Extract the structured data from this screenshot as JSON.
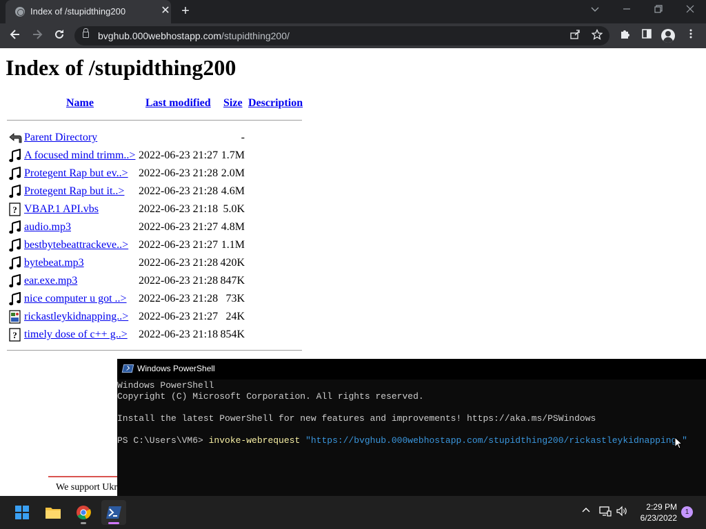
{
  "browser": {
    "tab_title": "Index of /stupidthing200",
    "tab_close": "✕",
    "new_tab": "+",
    "url_host": "bvghub.000webhostapp.com",
    "url_path": "/stupidthing200/",
    "window_controls": [
      "minimize",
      "restore",
      "close"
    ]
  },
  "page": {
    "heading": "Index of /stupidthing200",
    "columns": {
      "name": "Name",
      "last_modified": "Last modified",
      "size": "Size",
      "description": "Description"
    },
    "entries": [
      {
        "icon": "back-arrow",
        "name": "Parent Directory",
        "modified": "",
        "size": "-"
      },
      {
        "icon": "music-note",
        "name": "A focused mind trimm..>",
        "modified": "2022-06-23 21:27",
        "size": "1.7M"
      },
      {
        "icon": "music-note",
        "name": "Protegent Rap but ev..>",
        "modified": "2022-06-23 21:28",
        "size": "2.0M"
      },
      {
        "icon": "music-note",
        "name": "Protegent Rap but it..>",
        "modified": "2022-06-23 21:28",
        "size": "4.6M"
      },
      {
        "icon": "unknown-file",
        "name": "VBAP.1 API.vbs",
        "modified": "2022-06-23 21:18",
        "size": "5.0K"
      },
      {
        "icon": "music-note",
        "name": "audio.mp3",
        "modified": "2022-06-23 21:27",
        "size": "4.8M"
      },
      {
        "icon": "music-note",
        "name": "bestbytebeattrackeve..>",
        "modified": "2022-06-23 21:27",
        "size": "1.1M"
      },
      {
        "icon": "music-note",
        "name": "bytebeat.mp3",
        "modified": "2022-06-23 21:28",
        "size": "420K"
      },
      {
        "icon": "music-note",
        "name": "ear.exe.mp3",
        "modified": "2022-06-23 21:28",
        "size": "847K"
      },
      {
        "icon": "music-note",
        "name": "nice computer u got ..>",
        "modified": "2022-06-23 21:28",
        "size": "73K"
      },
      {
        "icon": "image-file",
        "name": "rickastleykidnapping..>",
        "modified": "2022-06-23 21:27",
        "size": "24K"
      },
      {
        "icon": "unknown-file",
        "name": "timely dose of c++ g..>",
        "modified": "2022-06-23 21:18",
        "size": "854K"
      }
    ],
    "banner_text": "We support Ukr"
  },
  "powershell": {
    "title": "Windows PowerShell",
    "lines": [
      "Windows PowerShell",
      "Copyright (C) Microsoft Corporation. All rights reserved.",
      "",
      "Install the latest PowerShell for new features and improvements! https://aka.ms/PSWindows",
      ""
    ],
    "prompt": "PS C:\\Users\\VM6> ",
    "command": "invoke-webrequest",
    "argument": "\"https://bvghub.000webhostapp.com/stupidthing200/rickastleykidnapping.\""
  },
  "taskbar": {
    "apps": [
      "start",
      "file-explorer",
      "chrome",
      "powershell"
    ],
    "time": "2:29 PM",
    "date": "6/23/2022",
    "notification_count": "1"
  },
  "colors": {
    "link": "#0000ee",
    "chrome_dark": "#35363a",
    "ps_string": "#3a96dd",
    "ps_command": "#f9f1a5"
  }
}
